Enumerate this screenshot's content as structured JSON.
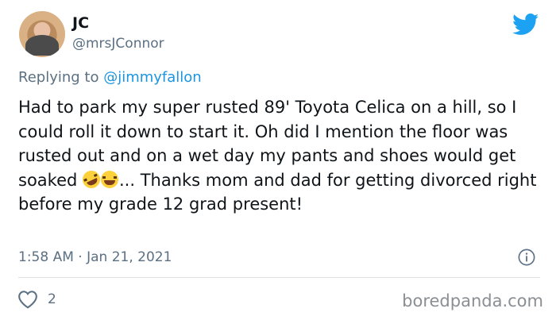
{
  "author": {
    "name": "JC",
    "handle": "@mrsJConnor"
  },
  "reply": {
    "prefix": "Replying to ",
    "mention": "@jimmyfallon"
  },
  "tweet": {
    "text_before_emoji": "Had to park my super rusted 89' Toyota Celica on a hill, so I could roll it down to start it. Oh did I mention the floor was rusted out and on a wet day my pants and shoes would get soaked ",
    "emojis": [
      "rolling-on-floor-laughing",
      "face-with-tears-of-joy"
    ],
    "text_after_emoji": "... Thanks mom and dad for getting divorced right before my grade 12 grad present!",
    "timestamp": "1:58 AM · Jan 21, 2021"
  },
  "stats": {
    "likes": "2"
  },
  "icons": {
    "brand": "twitter-bird-icon",
    "info": "info-icon",
    "like": "heart-icon"
  },
  "colors": {
    "twitter_blue": "#1da1f2",
    "mention": "#1b95e0",
    "secondary_text": "#5b7083"
  },
  "watermark": "boredpanda.com"
}
